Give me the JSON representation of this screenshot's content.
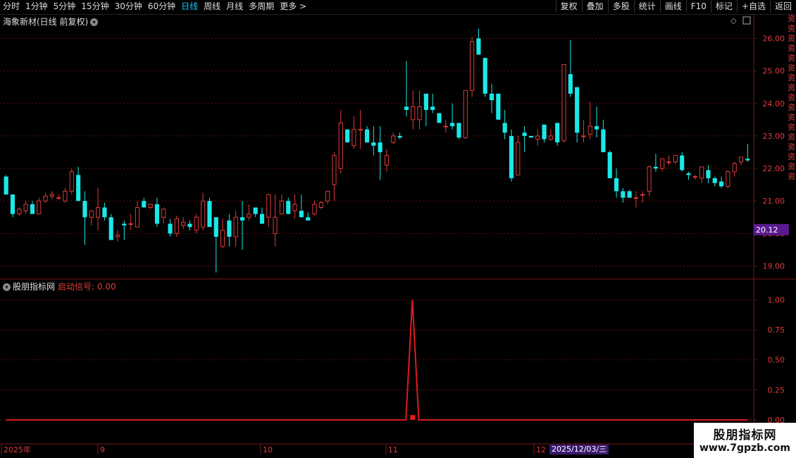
{
  "toolbar": {
    "periods": [
      "分时",
      "1分钟",
      "5分钟",
      "15分钟",
      "30分钟",
      "60分钟",
      "日线",
      "周线",
      "月线",
      "多周期",
      "更多 >"
    ],
    "active": "日线",
    "buttons": [
      "复权",
      "叠加",
      "多股",
      "统计",
      "画线",
      "F10",
      "标记",
      "+自选",
      "返回"
    ]
  },
  "chart_title": "海象新材(日线 前复权)",
  "last_price_label": "20.12",
  "indicator": {
    "name": "股朋指标网",
    "signal_label": "启动信号: 0.00"
  },
  "timeline": {
    "labels": [
      "2025年",
      "9",
      "10",
      "11",
      "12"
    ],
    "cursor_date": "2025/12/03/三"
  },
  "watermark": {
    "line1": "股朋指标网",
    "line2": "www.7gpzb.com"
  },
  "right_strip": "资\n资\n资\n资\n资\n资\n资\n资\n资\n资\n资\n资\n资\n资\n资\n资\n资",
  "colors": {
    "up": "#e03b3b",
    "down": "#19e8e8",
    "signal": "#e01b1b",
    "grid": "#5a0f0f",
    "axis_border": "#7a1a1a"
  },
  "chart_data": [
    {
      "type": "candlestick",
      "title": "海象新材(日线 前复权)",
      "ylim": [
        18.6,
        26.4
      ],
      "y_ticks": [
        19.0,
        20.0,
        21.0,
        22.0,
        23.0,
        24.0,
        25.0,
        26.0
      ],
      "grid": true,
      "series": [
        {
          "name": "K线",
          "ohlc": [
            [
              21.75,
              21.8,
              21.2,
              21.2
            ],
            [
              21.2,
              21.2,
              20.5,
              20.6
            ],
            [
              20.6,
              20.8,
              20.55,
              20.75
            ],
            [
              20.7,
              21.0,
              20.6,
              20.9
            ],
            [
              20.9,
              21.0,
              20.6,
              20.6
            ],
            [
              20.6,
              21.1,
              20.6,
              21.0
            ],
            [
              21.0,
              21.25,
              20.95,
              21.15
            ],
            [
              21.15,
              21.3,
              21.05,
              21.2
            ],
            [
              21.1,
              21.2,
              21.05,
              21.1
            ],
            [
              21.0,
              21.4,
              20.95,
              21.3
            ],
            [
              21.3,
              22.0,
              21.2,
              21.9
            ],
            [
              21.8,
              22.05,
              21.0,
              21.0
            ],
            [
              21.0,
              21.3,
              19.65,
              20.5
            ],
            [
              20.5,
              20.7,
              20.25,
              20.7
            ],
            [
              20.5,
              21.4,
              20.1,
              20.8
            ],
            [
              20.8,
              20.95,
              20.4,
              20.5
            ],
            [
              20.5,
              20.6,
              19.8,
              19.8
            ],
            [
              19.9,
              20.1,
              19.75,
              19.95
            ],
            [
              20.3,
              20.4,
              19.8,
              20.25
            ],
            [
              20.3,
              20.6,
              20.1,
              20.3
            ],
            [
              20.2,
              21.0,
              20.2,
              20.8
            ],
            [
              21.0,
              21.1,
              20.8,
              20.8
            ],
            [
              20.8,
              20.9,
              20.75,
              20.9
            ],
            [
              20.9,
              21.1,
              20.2,
              20.3
            ],
            [
              20.5,
              20.8,
              20.3,
              20.75
            ],
            [
              20.3,
              20.45,
              19.9,
              20.0
            ],
            [
              20.0,
              20.55,
              19.9,
              20.45
            ],
            [
              20.25,
              20.5,
              20.15,
              20.35
            ],
            [
              20.3,
              20.4,
              20.1,
              20.2
            ],
            [
              20.1,
              20.6,
              20.0,
              20.5
            ],
            [
              20.2,
              21.25,
              20.1,
              21.0
            ],
            [
              21.0,
              21.1,
              20.2,
              20.2
            ],
            [
              20.5,
              20.4,
              18.8,
              19.9
            ],
            [
              19.6,
              20.45,
              19.55,
              20.1
            ],
            [
              20.4,
              20.6,
              19.6,
              19.9
            ],
            [
              19.9,
              20.7,
              19.6,
              20.5
            ],
            [
              20.5,
              21.0,
              19.5,
              20.4
            ],
            [
              20.5,
              20.9,
              20.4,
              20.6
            ],
            [
              20.8,
              20.8,
              20.5,
              20.6
            ],
            [
              20.6,
              20.8,
              20.3,
              20.3
            ],
            [
              20.5,
              21.2,
              20.2,
              21.2
            ],
            [
              20.0,
              21.2,
              19.6,
              20.5
            ],
            [
              20.6,
              21.2,
              20.6,
              21.0
            ],
            [
              21.0,
              21.1,
              20.6,
              20.6
            ],
            [
              20.7,
              21.2,
              20.45,
              20.9
            ],
            [
              20.7,
              21.2,
              20.6,
              20.5
            ],
            [
              20.5,
              20.65,
              20.4,
              20.4
            ],
            [
              20.6,
              21.0,
              20.55,
              20.9
            ],
            [
              20.8,
              21.0,
              20.75,
              20.95
            ],
            [
              21.0,
              21.3,
              20.9,
              21.3
            ],
            [
              21.5,
              22.5,
              21.0,
              22.4
            ],
            [
              22.0,
              23.8,
              21.85,
              23.4
            ],
            [
              23.2,
              23.1,
              22.8,
              22.8
            ],
            [
              22.7,
              23.6,
              22.6,
              23.2
            ],
            [
              23.2,
              23.8,
              22.6,
              23.2
            ],
            [
              23.2,
              23.3,
              22.8,
              22.8
            ],
            [
              22.8,
              23.3,
              22.4,
              22.7
            ],
            [
              22.8,
              23.3,
              21.65,
              22.5
            ],
            [
              22.1,
              22.6,
              21.9,
              22.4
            ],
            [
              22.8,
              23.1,
              22.75,
              23.0
            ],
            [
              23.0,
              23.1,
              22.9,
              22.95
            ],
            [
              23.9,
              25.3,
              23.6,
              23.8
            ],
            [
              23.5,
              24.4,
              23.2,
              23.9
            ],
            [
              23.5,
              24.4,
              23.2,
              23.9
            ],
            [
              24.3,
              24.2,
              23.3,
              23.8
            ],
            [
              23.9,
              24.3,
              23.7,
              23.8
            ],
            [
              23.7,
              23.7,
              23.4,
              23.4
            ],
            [
              23.3,
              23.5,
              23.1,
              23.3
            ],
            [
              23.4,
              24.0,
              23.2,
              23.3
            ],
            [
              23.4,
              23.4,
              22.9,
              22.95
            ],
            [
              22.95,
              24.4,
              22.9,
              24.4
            ],
            [
              24.4,
              26.05,
              24.2,
              25.9
            ],
            [
              26.0,
              26.3,
              25.5,
              25.5
            ],
            [
              25.4,
              25.4,
              24.2,
              24.3
            ],
            [
              24.3,
              24.6,
              23.7,
              24.1
            ],
            [
              24.3,
              24.3,
              23.5,
              23.5
            ],
            [
              23.4,
              23.8,
              22.9,
              23.1
            ],
            [
              23.0,
              23.2,
              21.6,
              21.7
            ],
            [
              21.8,
              23.0,
              21.8,
              22.8
            ],
            [
              23.1,
              23.3,
              22.5,
              23.0
            ],
            [
              23.0,
              23.0,
              22.95,
              22.95
            ],
            [
              22.9,
              23.2,
              22.7,
              23.0
            ],
            [
              23.35,
              23.35,
              22.8,
              22.9
            ],
            [
              22.9,
              23.2,
              22.85,
              23.0
            ],
            [
              23.4,
              23.4,
              22.7,
              22.8
            ],
            [
              22.85,
              25.2,
              22.8,
              25.2
            ],
            [
              24.9,
              25.95,
              24.2,
              24.3
            ],
            [
              24.5,
              24.5,
              22.8,
              23.1
            ],
            [
              23.0,
              23.5,
              22.8,
              23.0
            ],
            [
              23.05,
              24.05,
              22.9,
              23.3
            ],
            [
              23.3,
              23.9,
              22.95,
              23.2
            ],
            [
              23.2,
              23.5,
              22.5,
              22.5
            ],
            [
              22.5,
              22.55,
              21.7,
              21.7
            ],
            [
              21.7,
              22.0,
              21.1,
              21.3
            ],
            [
              21.3,
              21.4,
              20.95,
              21.1
            ],
            [
              21.3,
              21.35,
              21.1,
              21.1
            ],
            [
              21.1,
              21.3,
              20.8,
              21.1
            ],
            [
              21.2,
              21.3,
              20.95,
              21.2
            ],
            [
              21.3,
              22.1,
              21.15,
              22.05
            ],
            [
              22.05,
              22.45,
              21.9,
              22.0
            ],
            [
              22.0,
              22.3,
              21.9,
              22.3
            ],
            [
              22.2,
              22.4,
              22.1,
              22.2
            ],
            [
              22.2,
              22.4,
              22.15,
              22.4
            ],
            [
              22.4,
              22.5,
              21.9,
              21.95
            ],
            [
              21.85,
              21.9,
              21.65,
              21.8
            ],
            [
              21.75,
              21.8,
              21.65,
              21.75
            ],
            [
              21.7,
              22.05,
              21.55,
              22.05
            ],
            [
              21.95,
              22.1,
              21.55,
              21.7
            ],
            [
              21.7,
              21.75,
              21.45,
              21.55
            ],
            [
              21.6,
              21.75,
              21.4,
              21.45
            ],
            [
              21.45,
              21.95,
              21.4,
              21.9
            ],
            [
              21.9,
              22.2,
              21.75,
              22.15
            ],
            [
              22.2,
              22.35,
              22.1,
              22.35
            ],
            [
              22.3,
              22.75,
              22.2,
              22.25
            ]
          ]
        }
      ]
    },
    {
      "type": "line",
      "title": "启动信号",
      "ylim": [
        -0.2,
        1.15
      ],
      "y_ticks": [
        0.0,
        0.25,
        0.5,
        0.75,
        1.0
      ],
      "grid": true,
      "series": [
        {
          "name": "启动信号",
          "values": [
            0,
            0,
            0,
            0,
            0,
            0,
            0,
            0,
            0,
            0,
            0,
            0,
            0,
            0,
            0,
            0,
            0,
            0,
            0,
            0,
            0,
            0,
            0,
            0,
            0,
            0,
            0,
            0,
            0,
            0,
            0,
            0,
            0,
            0,
            0,
            0,
            0,
            0,
            0,
            0,
            0,
            0,
            0,
            0,
            0,
            0,
            0,
            0,
            0,
            0,
            0,
            0,
            0,
            0,
            0,
            0,
            0,
            0,
            0,
            0,
            0,
            0,
            0,
            1,
            0,
            0,
            0,
            0,
            0,
            0,
            0,
            0,
            0,
            0,
            0,
            0,
            0,
            0,
            0,
            0,
            0,
            0,
            0,
            0,
            0,
            0,
            0,
            0,
            0,
            0,
            0,
            0,
            0,
            0,
            0,
            0,
            0,
            0,
            0,
            0,
            0,
            0,
            0,
            0,
            0,
            0,
            0,
            0,
            0,
            0,
            0,
            0,
            0,
            0,
            0,
            0
          ],
          "marker_index": 63
        }
      ]
    }
  ]
}
